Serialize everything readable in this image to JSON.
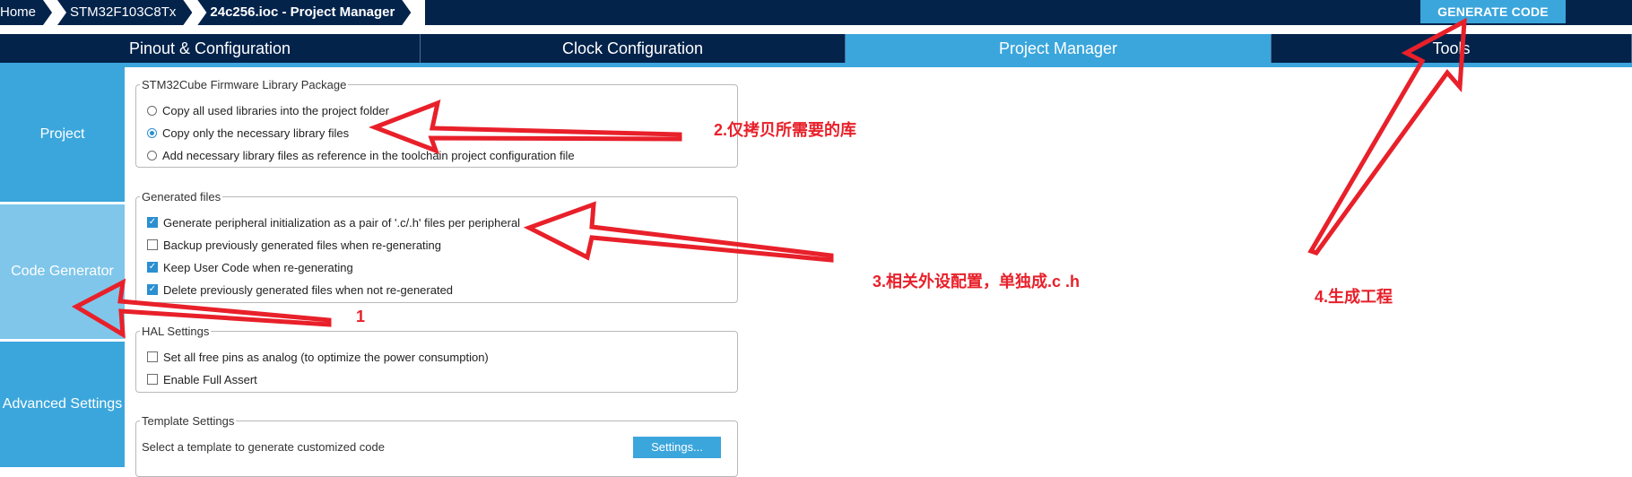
{
  "breadcrumbs": [
    "Home",
    "STM32F103C8Tx",
    "24c256.ioc - Project Manager"
  ],
  "generate_button": "GENERATE CODE",
  "tabs": [
    {
      "label": "Pinout & Configuration",
      "active": false
    },
    {
      "label": "Clock Configuration",
      "active": false
    },
    {
      "label": "Project Manager",
      "active": true
    },
    {
      "label": "Tools",
      "active": false
    }
  ],
  "sidebar": {
    "items": [
      {
        "label": "Project"
      },
      {
        "label": "Code Generator",
        "selected": true
      },
      {
        "label": "Advanced Settings"
      }
    ]
  },
  "firmware": {
    "legend": "STM32Cube Firmware Library Package",
    "options": [
      {
        "label": "Copy all used libraries into the project folder",
        "selected": false
      },
      {
        "label": "Copy only the necessary library files",
        "selected": true
      },
      {
        "label": "Add necessary library files as reference in the toolchain project configuration file",
        "selected": false
      }
    ]
  },
  "generated": {
    "legend": "Generated files",
    "options": [
      {
        "label": "Generate peripheral initialization as a pair of '.c/.h' files per peripheral",
        "checked": true
      },
      {
        "label": "Backup previously generated files when re-generating",
        "checked": false
      },
      {
        "label": "Keep User Code when re-generating",
        "checked": true
      },
      {
        "label": "Delete previously generated files when not re-generated",
        "checked": true
      }
    ]
  },
  "hal": {
    "legend": "HAL Settings",
    "options": [
      {
        "label": "Set all free pins as analog (to optimize the power consumption)",
        "checked": false
      },
      {
        "label": "Enable Full Assert",
        "checked": false
      }
    ]
  },
  "template": {
    "legend": "Template Settings",
    "text": "Select a template to generate customized code",
    "button": "Settings..."
  },
  "annotations": {
    "a1": "1",
    "a2": "2.仅拷贝所需要的库",
    "a3": "3.相关外设配置，单独成.c .h",
    "a4": "4.生成工程"
  },
  "colors": {
    "navy": "#03234b",
    "accent": "#3ba6dc",
    "annotation": "#e8202a"
  }
}
